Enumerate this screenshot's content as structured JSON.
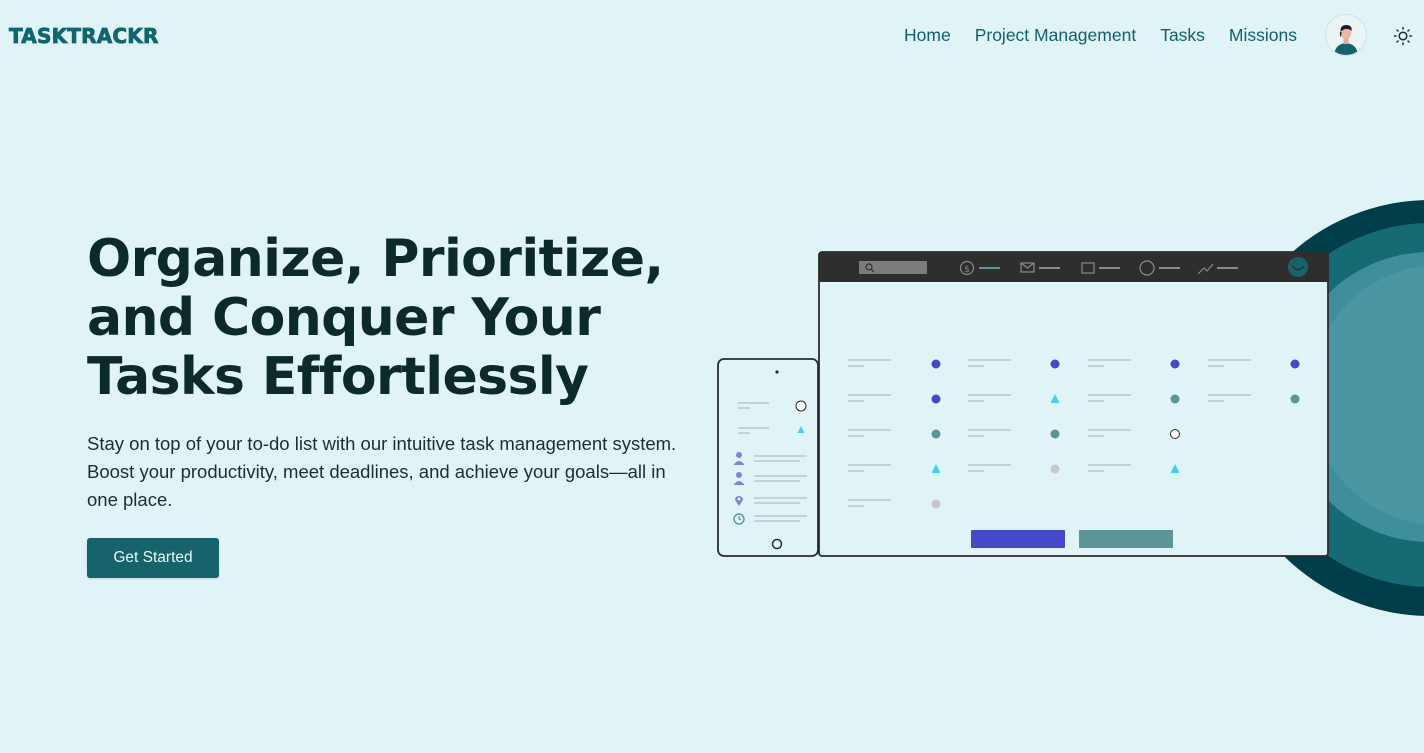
{
  "brand": {
    "name": "TASKTRACKR",
    "color": "#11656e"
  },
  "nav": {
    "links": [
      {
        "label": "Home"
      },
      {
        "label": "Project Management"
      },
      {
        "label": "Tasks"
      },
      {
        "label": "Missions"
      }
    ],
    "avatar_icon": "user-avatar-icon",
    "theme_icon": "sun-icon"
  },
  "hero": {
    "title": "Organize, Prioritize, and Conquer Your Tasks Effortlessly",
    "subtitle": "Stay on top of your to-do list with our intuitive task management system. Boost your productivity, meet deadlines, and achieve your goals—all in one place.",
    "cta_label": "Get Started"
  },
  "colors": {
    "background": "#e0f4f7",
    "primary": "#17636c",
    "accent_blue": "#4349c8",
    "accent_teal": "#5a9598",
    "accent_cyan": "#3ed3e6",
    "dark_teal": "#003f4a"
  }
}
